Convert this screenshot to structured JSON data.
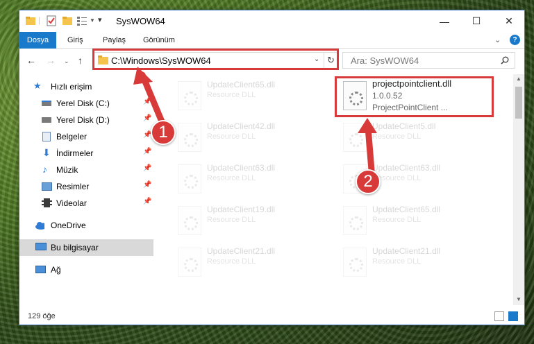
{
  "window": {
    "title": "SysWOW64"
  },
  "ribbon": {
    "tabs": [
      "Dosya",
      "Giriş",
      "Paylaş",
      "Görünüm"
    ]
  },
  "address": {
    "path": "C:\\Windows\\SysWOW64"
  },
  "search": {
    "placeholder": "Ara: SysWOW64"
  },
  "sidebar": {
    "items": [
      {
        "label": "Hızlı erişim",
        "icon": "star-icon"
      },
      {
        "label": "Yerel Disk (C:)",
        "icon": "drive-icon",
        "pinned": true
      },
      {
        "label": "Yerel Disk (D:)",
        "icon": "drive-icon",
        "pinned": true
      },
      {
        "label": "Belgeler",
        "icon": "documents-icon",
        "pinned": true
      },
      {
        "label": "İndirmeler",
        "icon": "download-icon",
        "pinned": true
      },
      {
        "label": "Müzik",
        "icon": "music-icon",
        "pinned": true
      },
      {
        "label": "Resimler",
        "icon": "pictures-icon",
        "pinned": true
      },
      {
        "label": "Videolar",
        "icon": "video-icon",
        "pinned": true
      },
      {
        "label": "OneDrive",
        "icon": "cloud-icon"
      },
      {
        "label": "Bu bilgisayar",
        "icon": "computer-icon",
        "selected": true
      },
      {
        "label": "Ağ",
        "icon": "network-icon"
      }
    ]
  },
  "files": {
    "left": [
      {
        "name": "UpdateClient65.dll",
        "type": "Resource DLL"
      },
      {
        "name": "UpdateClient42.dll",
        "type": "Resource DLL"
      },
      {
        "name": "UpdateClient63.dll",
        "type": "Resource DLL"
      },
      {
        "name": "UpdateClient19.dll",
        "type": "Resource DLL"
      },
      {
        "name": "UpdateClient21.dll",
        "type": "Resource DLL"
      }
    ],
    "highlighted": {
      "name": "projectpointclient.dll",
      "version": "1.0.0.52",
      "description": "ProjectPointClient ..."
    },
    "right": [
      {
        "name": "UpdateClient5.dll",
        "type": "Resource DLL"
      },
      {
        "name": "UpdateClient63.dll",
        "type": "Resource DLL"
      },
      {
        "name": "UpdateClient65.dll",
        "type": "Resource DLL"
      },
      {
        "name": "UpdateClient21.dll",
        "type": "Resource DLL"
      }
    ]
  },
  "status": {
    "count": "129 öğe"
  },
  "annotations": {
    "step1": "1",
    "step2": "2"
  },
  "colors": {
    "accent": "#1979ca",
    "highlight": "#d63a3a"
  }
}
